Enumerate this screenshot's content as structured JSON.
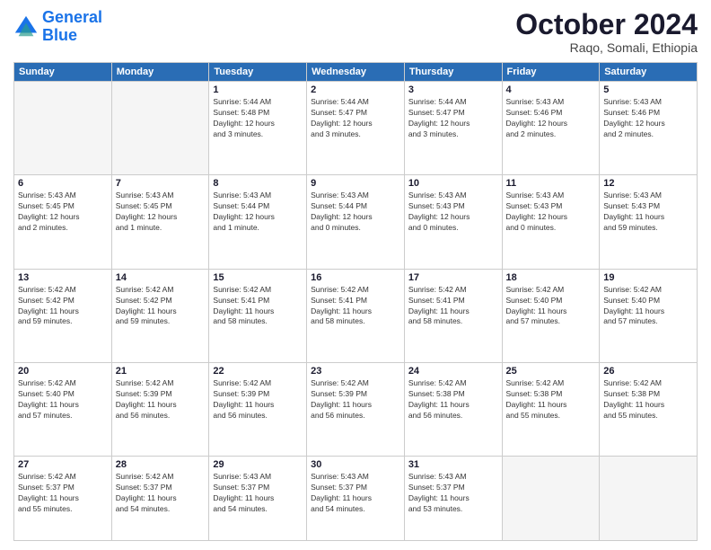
{
  "logo": {
    "line1": "General",
    "line2": "Blue"
  },
  "title": "October 2024",
  "location": "Raqo, Somali, Ethiopia",
  "weekdays": [
    "Sunday",
    "Monday",
    "Tuesday",
    "Wednesday",
    "Thursday",
    "Friday",
    "Saturday"
  ],
  "weeks": [
    [
      {
        "day": "",
        "info": ""
      },
      {
        "day": "",
        "info": ""
      },
      {
        "day": "1",
        "info": "Sunrise: 5:44 AM\nSunset: 5:48 PM\nDaylight: 12 hours\nand 3 minutes."
      },
      {
        "day": "2",
        "info": "Sunrise: 5:44 AM\nSunset: 5:47 PM\nDaylight: 12 hours\nand 3 minutes."
      },
      {
        "day": "3",
        "info": "Sunrise: 5:44 AM\nSunset: 5:47 PM\nDaylight: 12 hours\nand 3 minutes."
      },
      {
        "day": "4",
        "info": "Sunrise: 5:43 AM\nSunset: 5:46 PM\nDaylight: 12 hours\nand 2 minutes."
      },
      {
        "day": "5",
        "info": "Sunrise: 5:43 AM\nSunset: 5:46 PM\nDaylight: 12 hours\nand 2 minutes."
      }
    ],
    [
      {
        "day": "6",
        "info": "Sunrise: 5:43 AM\nSunset: 5:45 PM\nDaylight: 12 hours\nand 2 minutes."
      },
      {
        "day": "7",
        "info": "Sunrise: 5:43 AM\nSunset: 5:45 PM\nDaylight: 12 hours\nand 1 minute."
      },
      {
        "day": "8",
        "info": "Sunrise: 5:43 AM\nSunset: 5:44 PM\nDaylight: 12 hours\nand 1 minute."
      },
      {
        "day": "9",
        "info": "Sunrise: 5:43 AM\nSunset: 5:44 PM\nDaylight: 12 hours\nand 0 minutes."
      },
      {
        "day": "10",
        "info": "Sunrise: 5:43 AM\nSunset: 5:43 PM\nDaylight: 12 hours\nand 0 minutes."
      },
      {
        "day": "11",
        "info": "Sunrise: 5:43 AM\nSunset: 5:43 PM\nDaylight: 12 hours\nand 0 minutes."
      },
      {
        "day": "12",
        "info": "Sunrise: 5:43 AM\nSunset: 5:43 PM\nDaylight: 11 hours\nand 59 minutes."
      }
    ],
    [
      {
        "day": "13",
        "info": "Sunrise: 5:42 AM\nSunset: 5:42 PM\nDaylight: 11 hours\nand 59 minutes."
      },
      {
        "day": "14",
        "info": "Sunrise: 5:42 AM\nSunset: 5:42 PM\nDaylight: 11 hours\nand 59 minutes."
      },
      {
        "day": "15",
        "info": "Sunrise: 5:42 AM\nSunset: 5:41 PM\nDaylight: 11 hours\nand 58 minutes."
      },
      {
        "day": "16",
        "info": "Sunrise: 5:42 AM\nSunset: 5:41 PM\nDaylight: 11 hours\nand 58 minutes."
      },
      {
        "day": "17",
        "info": "Sunrise: 5:42 AM\nSunset: 5:41 PM\nDaylight: 11 hours\nand 58 minutes."
      },
      {
        "day": "18",
        "info": "Sunrise: 5:42 AM\nSunset: 5:40 PM\nDaylight: 11 hours\nand 57 minutes."
      },
      {
        "day": "19",
        "info": "Sunrise: 5:42 AM\nSunset: 5:40 PM\nDaylight: 11 hours\nand 57 minutes."
      }
    ],
    [
      {
        "day": "20",
        "info": "Sunrise: 5:42 AM\nSunset: 5:40 PM\nDaylight: 11 hours\nand 57 minutes."
      },
      {
        "day": "21",
        "info": "Sunrise: 5:42 AM\nSunset: 5:39 PM\nDaylight: 11 hours\nand 56 minutes."
      },
      {
        "day": "22",
        "info": "Sunrise: 5:42 AM\nSunset: 5:39 PM\nDaylight: 11 hours\nand 56 minutes."
      },
      {
        "day": "23",
        "info": "Sunrise: 5:42 AM\nSunset: 5:39 PM\nDaylight: 11 hours\nand 56 minutes."
      },
      {
        "day": "24",
        "info": "Sunrise: 5:42 AM\nSunset: 5:38 PM\nDaylight: 11 hours\nand 56 minutes."
      },
      {
        "day": "25",
        "info": "Sunrise: 5:42 AM\nSunset: 5:38 PM\nDaylight: 11 hours\nand 55 minutes."
      },
      {
        "day": "26",
        "info": "Sunrise: 5:42 AM\nSunset: 5:38 PM\nDaylight: 11 hours\nand 55 minutes."
      }
    ],
    [
      {
        "day": "27",
        "info": "Sunrise: 5:42 AM\nSunset: 5:37 PM\nDaylight: 11 hours\nand 55 minutes."
      },
      {
        "day": "28",
        "info": "Sunrise: 5:42 AM\nSunset: 5:37 PM\nDaylight: 11 hours\nand 54 minutes."
      },
      {
        "day": "29",
        "info": "Sunrise: 5:43 AM\nSunset: 5:37 PM\nDaylight: 11 hours\nand 54 minutes."
      },
      {
        "day": "30",
        "info": "Sunrise: 5:43 AM\nSunset: 5:37 PM\nDaylight: 11 hours\nand 54 minutes."
      },
      {
        "day": "31",
        "info": "Sunrise: 5:43 AM\nSunset: 5:37 PM\nDaylight: 11 hours\nand 53 minutes."
      },
      {
        "day": "",
        "info": ""
      },
      {
        "day": "",
        "info": ""
      }
    ]
  ]
}
